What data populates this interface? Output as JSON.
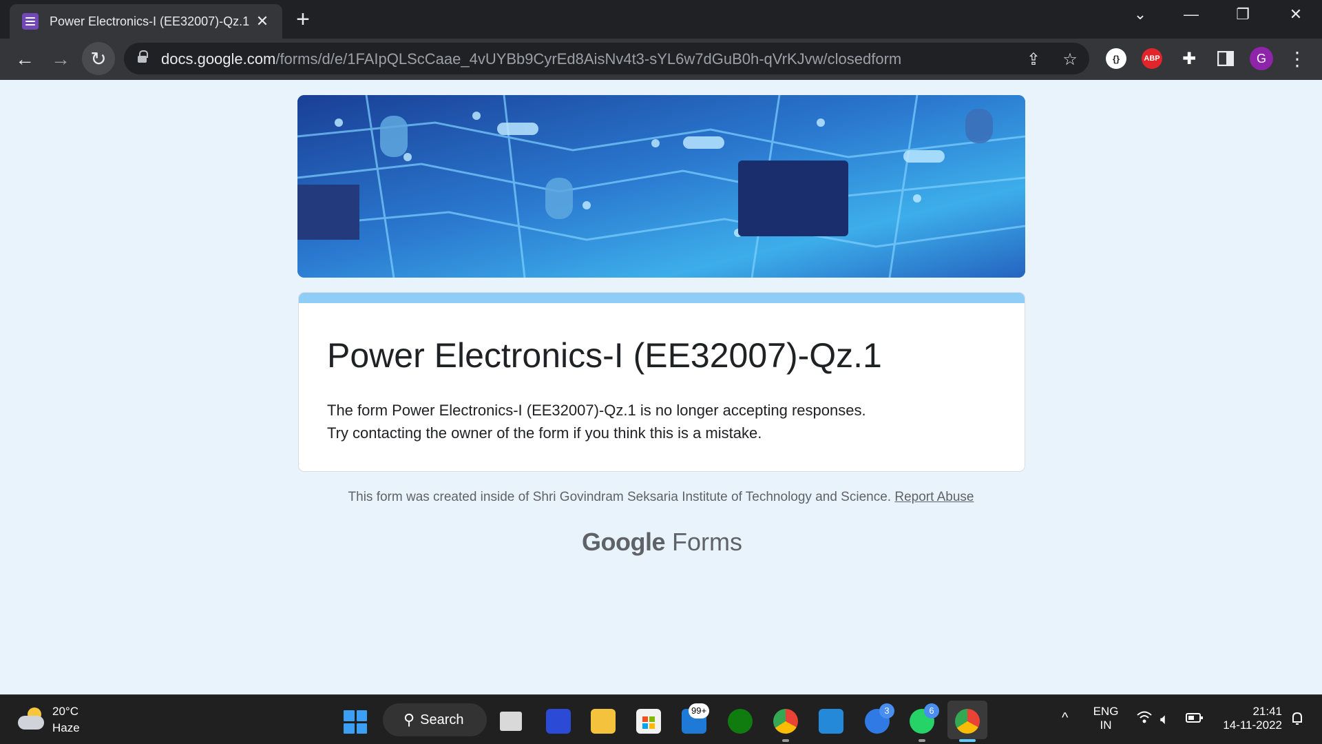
{
  "browser": {
    "tab_title": "Power Electronics-I (EE32007)-Qz.1",
    "tab_close": "✕",
    "new_tab": "+",
    "url_host": "docs.google.com",
    "url_path": "/forms/d/e/1FAIpQLScCaae_4vUYBb9CyrEd8AisNv4t3-sYL6w7dGuB0h-qVrKJvw/closedform",
    "back": "←",
    "forward": "→",
    "reload": "↻",
    "share": "⇪",
    "star": "☆",
    "menu": "⋮",
    "minimize": "—",
    "restore": "❐",
    "close": "✕",
    "dropdown": "⌄",
    "ext_abp": "ABP",
    "profile_initial": "G"
  },
  "form": {
    "title": "Power Electronics-I (EE32007)-Qz.1",
    "message_line1": "The form Power Electronics-I (EE32007)-Qz.1 is no longer accepting responses.",
    "message_line2": "Try contacting the owner of the form if you think this is a mistake.",
    "footer": "This form was created inside of Shri Govindram Seksaria Institute of Technology and Science. ",
    "report_abuse": "Report Abuse",
    "brand_google": "Google",
    "brand_forms": " Forms"
  },
  "colors": {
    "form_accent": "#8ecdf5",
    "page_bg": "#e8f3fb",
    "chrome_dark": "#202124"
  },
  "taskbar": {
    "temperature": "20°C",
    "condition": "Haze",
    "search_label": "Search",
    "search_symbol": "⚲",
    "badge_mail": "99+",
    "badge_todo": "3",
    "badge_whatsapp": "6",
    "language": "ENG",
    "region": "IN",
    "time": "21:41",
    "date": "14-11-2022",
    "tray_chevron": "^",
    "tray_volume": "🔈︎"
  }
}
